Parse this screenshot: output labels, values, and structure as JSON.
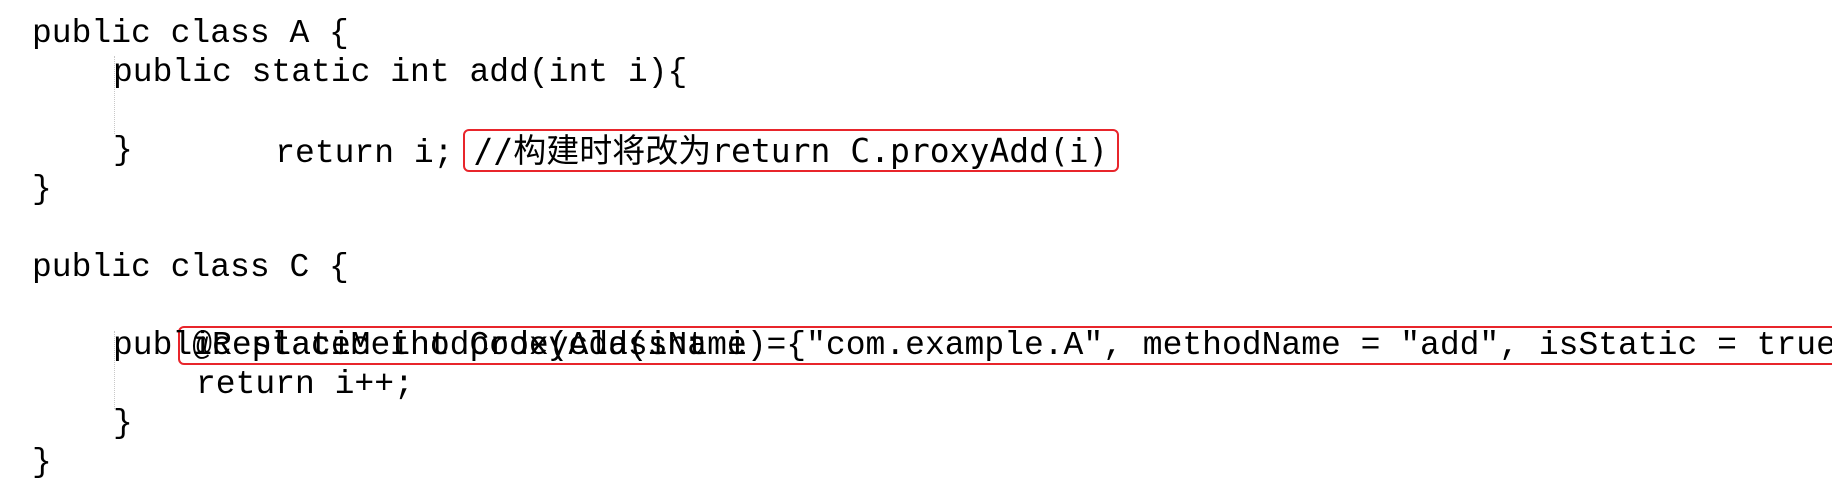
{
  "code": {
    "class_a_open": "public class A {",
    "class_a_method_sig": "public static int add(int i){",
    "class_a_return": "return i;",
    "class_a_comment": "//构建时将改为return C.proxyAdd(i)",
    "class_a_method_close": "}",
    "class_a_close": "}",
    "class_c_open": "public class C {",
    "class_c_annotation": "@ReplaceMethodCode(className = \"com.example.A\", methodName = \"add\", isStatic = true)",
    "class_c_method_sig": "public static int proxyAdd(int i) {",
    "class_c_return": "return i++;",
    "class_c_method_close": "}",
    "class_c_close": "}"
  },
  "highlight_color": "#e8252b"
}
